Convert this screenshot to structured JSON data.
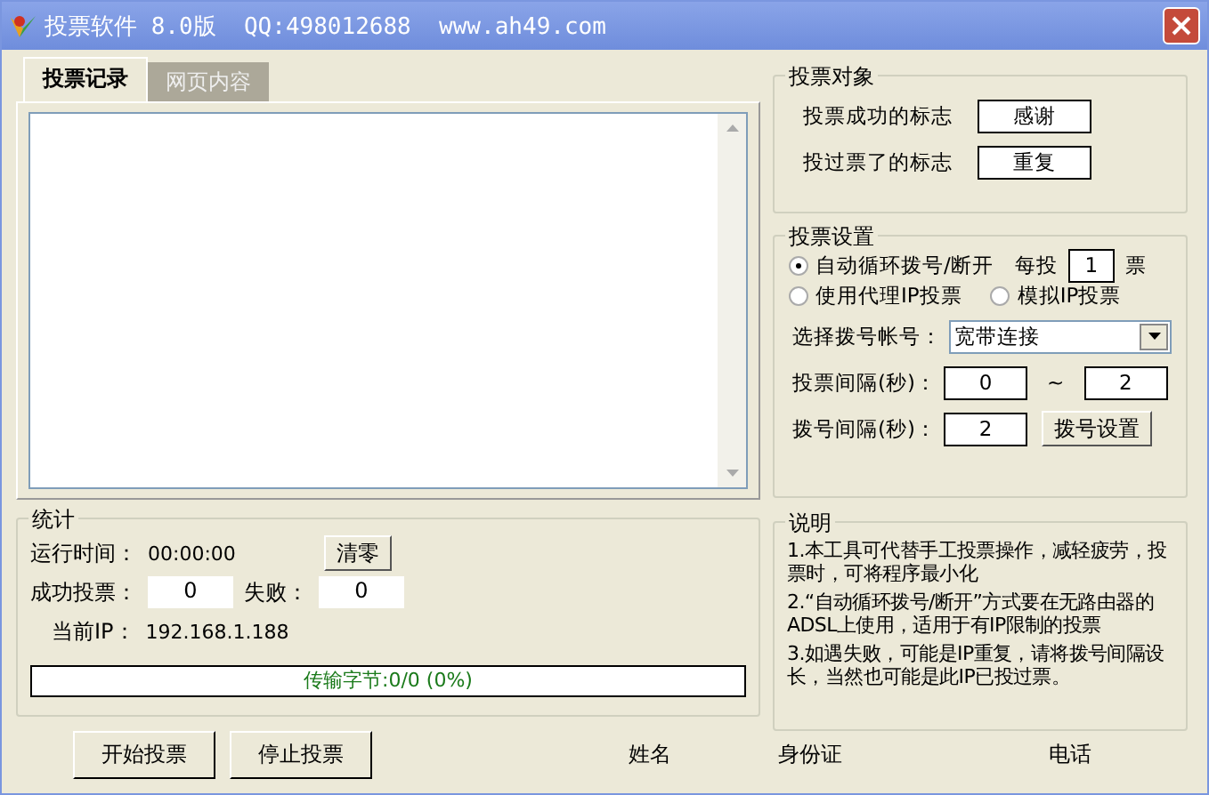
{
  "window": {
    "title": "投票软件 8.0版  QQ:498012688  www.ah49.com"
  },
  "tabs": [
    {
      "label": "投票记录",
      "selected": true
    },
    {
      "label": "网页内容",
      "selected": false
    }
  ],
  "stats": {
    "title": "统计",
    "runtime_label": "运行时间：",
    "runtime": "00:00:00",
    "reset_button": "清零",
    "success_label": "成功投票：",
    "success": "0",
    "fail_label": "失败：",
    "fail": "0",
    "ip_label": "当前IP：",
    "ip": "192.168.1.188",
    "progress": {
      "level": 0,
      "text": "传输字节:0/0 (0%)"
    }
  },
  "buttons": [
    {
      "label": "开始投票"
    },
    {
      "label": "停止投票"
    }
  ],
  "footer_labels": [
    "姓名",
    "身份证",
    "电话"
  ],
  "target": {
    "title": "投票对象",
    "rows": [
      {
        "label": "投票成功的标志",
        "value": "感谢"
      },
      {
        "label": "投过票了的标志",
        "value": "重复"
      }
    ]
  },
  "settings": {
    "title": "投票设置",
    "options": [
      {
        "label": "自动循环拨号/断开",
        "selected": true
      },
      {
        "label": "使用代理IP投票",
        "selected": false
      },
      {
        "label": "模拟IP投票",
        "selected": false
      }
    ],
    "per_label": "每投",
    "per_value": "1",
    "per_unit": "票",
    "account_label": "选择拨号帐号：",
    "account": "宽带连接",
    "vote_interval_label": "投票间隔(秒)：",
    "vote_min": "0",
    "tilde": "~",
    "vote_max": "2",
    "dial_interval_label": "拨号间隔(秒)：",
    "dial_interval": "2",
    "dial_button": "拨号设置"
  },
  "notes": {
    "title": "说明",
    "items": [
      "1.本工具可代替手工投票操作，减轻疲劳，投票时，可将程序最小化",
      "2.“自动循环拨号/断开”方式要在无路由器的ADSL上使用，适用于有IP限制的投票",
      "3.如遇失败，可能是IP重复，请将拨号间隔设长，当然也可能是此IP已投过票。"
    ]
  }
}
